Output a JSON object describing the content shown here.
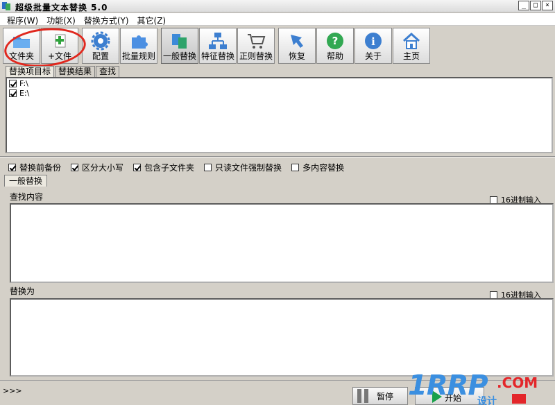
{
  "window": {
    "title": "超级批量文本替换 5.0",
    "controls": [
      "_",
      "□",
      "×"
    ]
  },
  "menu": [
    "程序(W)",
    "功能(X)",
    "替换方式(Y)",
    "其它(Z)"
  ],
  "toolbar": {
    "folder": "文件夹",
    "add_file": "+文件",
    "config": "配置",
    "batch_rules": "批量规则",
    "normal_replace": "一般替换",
    "feature_replace": "特征替换",
    "regex_replace": "正则替换",
    "restore": "恢复",
    "help": "帮助",
    "about": "关于",
    "home": "主页"
  },
  "tabs": [
    "替换项目标",
    "替换结果",
    "查找"
  ],
  "targets": [
    {
      "label": "F:\\",
      "checked": true
    },
    {
      "label": "E:\\",
      "checked": true
    }
  ],
  "options": [
    {
      "label": "替换前备份",
      "checked": true
    },
    {
      "label": "区分大小写",
      "checked": true
    },
    {
      "label": "包含子文件夹",
      "checked": true
    },
    {
      "label": "只读文件强制替换",
      "checked": false
    },
    {
      "label": "多内容替换",
      "checked": false
    }
  ],
  "mode_tab": "一般替换",
  "find": {
    "label": "查找内容",
    "hex_label": "16进制输入",
    "hex_checked": false,
    "value": ""
  },
  "replace": {
    "label": "替换为",
    "hex_label": "16进制输入",
    "hex_checked": false,
    "value": ""
  },
  "status": {
    "text": ">>>"
  },
  "buttons": {
    "pause": "暂停",
    "start": "开始"
  },
  "watermark": {
    "main": "1RRP",
    "suffix": ".COM",
    "sub": "设计"
  },
  "colors": {
    "highlight": "#e0281e",
    "watermark_blue": "#3b8fe0",
    "watermark_red": "#e3262a"
  }
}
